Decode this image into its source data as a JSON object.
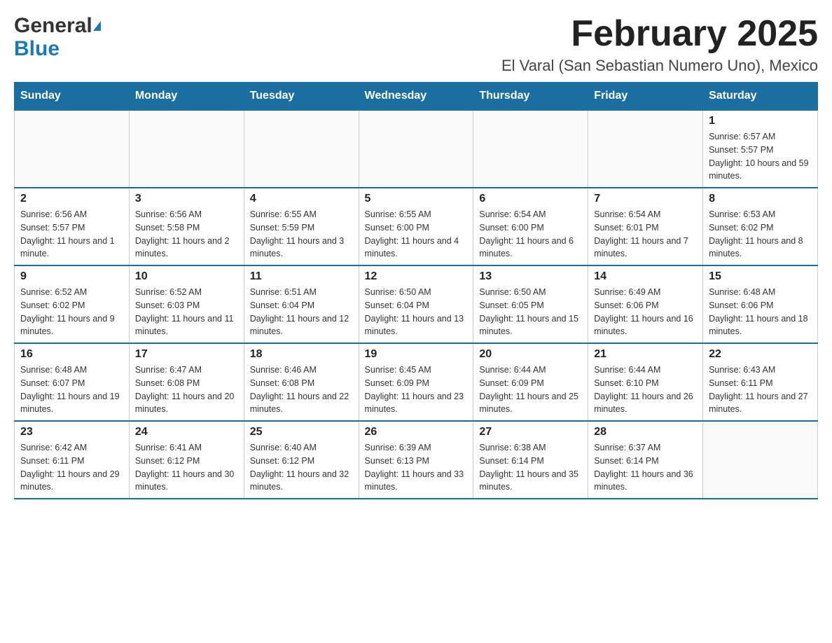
{
  "header": {
    "logo_general": "General",
    "logo_blue": "Blue",
    "month_title": "February 2025",
    "location": "El Varal (San Sebastian Numero Uno), Mexico"
  },
  "weekdays": [
    "Sunday",
    "Monday",
    "Tuesday",
    "Wednesday",
    "Thursday",
    "Friday",
    "Saturday"
  ],
  "weeks": [
    [
      {
        "day": "",
        "sunrise": "",
        "sunset": "",
        "daylight": "",
        "empty": true
      },
      {
        "day": "",
        "sunrise": "",
        "sunset": "",
        "daylight": "",
        "empty": true
      },
      {
        "day": "",
        "sunrise": "",
        "sunset": "",
        "daylight": "",
        "empty": true
      },
      {
        "day": "",
        "sunrise": "",
        "sunset": "",
        "daylight": "",
        "empty": true
      },
      {
        "day": "",
        "sunrise": "",
        "sunset": "",
        "daylight": "",
        "empty": true
      },
      {
        "day": "",
        "sunrise": "",
        "sunset": "",
        "daylight": "",
        "empty": true
      },
      {
        "day": "1",
        "sunrise": "Sunrise: 6:57 AM",
        "sunset": "Sunset: 5:57 PM",
        "daylight": "Daylight: 10 hours and 59 minutes.",
        "empty": false
      }
    ],
    [
      {
        "day": "2",
        "sunrise": "Sunrise: 6:56 AM",
        "sunset": "Sunset: 5:57 PM",
        "daylight": "Daylight: 11 hours and 1 minute.",
        "empty": false
      },
      {
        "day": "3",
        "sunrise": "Sunrise: 6:56 AM",
        "sunset": "Sunset: 5:58 PM",
        "daylight": "Daylight: 11 hours and 2 minutes.",
        "empty": false
      },
      {
        "day": "4",
        "sunrise": "Sunrise: 6:55 AM",
        "sunset": "Sunset: 5:59 PM",
        "daylight": "Daylight: 11 hours and 3 minutes.",
        "empty": false
      },
      {
        "day": "5",
        "sunrise": "Sunrise: 6:55 AM",
        "sunset": "Sunset: 6:00 PM",
        "daylight": "Daylight: 11 hours and 4 minutes.",
        "empty": false
      },
      {
        "day": "6",
        "sunrise": "Sunrise: 6:54 AM",
        "sunset": "Sunset: 6:00 PM",
        "daylight": "Daylight: 11 hours and 6 minutes.",
        "empty": false
      },
      {
        "day": "7",
        "sunrise": "Sunrise: 6:54 AM",
        "sunset": "Sunset: 6:01 PM",
        "daylight": "Daylight: 11 hours and 7 minutes.",
        "empty": false
      },
      {
        "day": "8",
        "sunrise": "Sunrise: 6:53 AM",
        "sunset": "Sunset: 6:02 PM",
        "daylight": "Daylight: 11 hours and 8 minutes.",
        "empty": false
      }
    ],
    [
      {
        "day": "9",
        "sunrise": "Sunrise: 6:52 AM",
        "sunset": "Sunset: 6:02 PM",
        "daylight": "Daylight: 11 hours and 9 minutes.",
        "empty": false
      },
      {
        "day": "10",
        "sunrise": "Sunrise: 6:52 AM",
        "sunset": "Sunset: 6:03 PM",
        "daylight": "Daylight: 11 hours and 11 minutes.",
        "empty": false
      },
      {
        "day": "11",
        "sunrise": "Sunrise: 6:51 AM",
        "sunset": "Sunset: 6:04 PM",
        "daylight": "Daylight: 11 hours and 12 minutes.",
        "empty": false
      },
      {
        "day": "12",
        "sunrise": "Sunrise: 6:50 AM",
        "sunset": "Sunset: 6:04 PM",
        "daylight": "Daylight: 11 hours and 13 minutes.",
        "empty": false
      },
      {
        "day": "13",
        "sunrise": "Sunrise: 6:50 AM",
        "sunset": "Sunset: 6:05 PM",
        "daylight": "Daylight: 11 hours and 15 minutes.",
        "empty": false
      },
      {
        "day": "14",
        "sunrise": "Sunrise: 6:49 AM",
        "sunset": "Sunset: 6:06 PM",
        "daylight": "Daylight: 11 hours and 16 minutes.",
        "empty": false
      },
      {
        "day": "15",
        "sunrise": "Sunrise: 6:48 AM",
        "sunset": "Sunset: 6:06 PM",
        "daylight": "Daylight: 11 hours and 18 minutes.",
        "empty": false
      }
    ],
    [
      {
        "day": "16",
        "sunrise": "Sunrise: 6:48 AM",
        "sunset": "Sunset: 6:07 PM",
        "daylight": "Daylight: 11 hours and 19 minutes.",
        "empty": false
      },
      {
        "day": "17",
        "sunrise": "Sunrise: 6:47 AM",
        "sunset": "Sunset: 6:08 PM",
        "daylight": "Daylight: 11 hours and 20 minutes.",
        "empty": false
      },
      {
        "day": "18",
        "sunrise": "Sunrise: 6:46 AM",
        "sunset": "Sunset: 6:08 PM",
        "daylight": "Daylight: 11 hours and 22 minutes.",
        "empty": false
      },
      {
        "day": "19",
        "sunrise": "Sunrise: 6:45 AM",
        "sunset": "Sunset: 6:09 PM",
        "daylight": "Daylight: 11 hours and 23 minutes.",
        "empty": false
      },
      {
        "day": "20",
        "sunrise": "Sunrise: 6:44 AM",
        "sunset": "Sunset: 6:09 PM",
        "daylight": "Daylight: 11 hours and 25 minutes.",
        "empty": false
      },
      {
        "day": "21",
        "sunrise": "Sunrise: 6:44 AM",
        "sunset": "Sunset: 6:10 PM",
        "daylight": "Daylight: 11 hours and 26 minutes.",
        "empty": false
      },
      {
        "day": "22",
        "sunrise": "Sunrise: 6:43 AM",
        "sunset": "Sunset: 6:11 PM",
        "daylight": "Daylight: 11 hours and 27 minutes.",
        "empty": false
      }
    ],
    [
      {
        "day": "23",
        "sunrise": "Sunrise: 6:42 AM",
        "sunset": "Sunset: 6:11 PM",
        "daylight": "Daylight: 11 hours and 29 minutes.",
        "empty": false
      },
      {
        "day": "24",
        "sunrise": "Sunrise: 6:41 AM",
        "sunset": "Sunset: 6:12 PM",
        "daylight": "Daylight: 11 hours and 30 minutes.",
        "empty": false
      },
      {
        "day": "25",
        "sunrise": "Sunrise: 6:40 AM",
        "sunset": "Sunset: 6:12 PM",
        "daylight": "Daylight: 11 hours and 32 minutes.",
        "empty": false
      },
      {
        "day": "26",
        "sunrise": "Sunrise: 6:39 AM",
        "sunset": "Sunset: 6:13 PM",
        "daylight": "Daylight: 11 hours and 33 minutes.",
        "empty": false
      },
      {
        "day": "27",
        "sunrise": "Sunrise: 6:38 AM",
        "sunset": "Sunset: 6:14 PM",
        "daylight": "Daylight: 11 hours and 35 minutes.",
        "empty": false
      },
      {
        "day": "28",
        "sunrise": "Sunrise: 6:37 AM",
        "sunset": "Sunset: 6:14 PM",
        "daylight": "Daylight: 11 hours and 36 minutes.",
        "empty": false
      },
      {
        "day": "",
        "sunrise": "",
        "sunset": "",
        "daylight": "",
        "empty": true
      }
    ]
  ]
}
